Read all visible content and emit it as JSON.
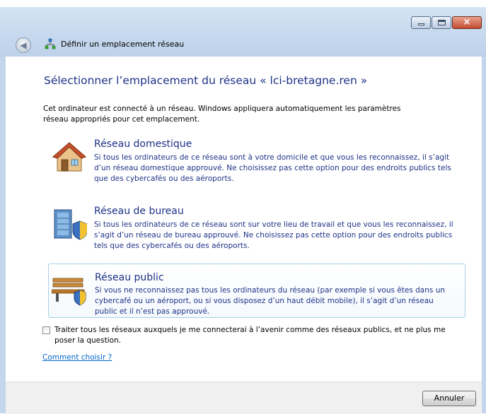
{
  "window": {
    "title": "Définir un emplacement réseau",
    "caption_buttons": {
      "minimize": "minimize",
      "maximize": "maximize",
      "close": "×"
    }
  },
  "nav": {
    "back_glyph": "◀",
    "icon": "network-icon"
  },
  "page": {
    "heading": "Sélectionner l’emplacement du réseau « lci-bretagne.ren »",
    "intro": "Cet ordinateur est connecté à un réseau. Windows appliquera automatiquement les paramètres réseau appropriés pour cet emplacement."
  },
  "options": [
    {
      "title": "Réseau domestique",
      "description": "Si tous les ordinateurs de ce réseau sont à votre domicile et que vous les reconnaissez, il s’agit d’un réseau domestique approuvé. Ne choisissez pas cette option pour des endroits publics tels que des cybercafés ou des aéroports.",
      "icon": "house-icon"
    },
    {
      "title": "Réseau de bureau",
      "description": "Si tous les ordinateurs de ce réseau sont sur votre lieu de travail et que vous les reconnaissez, il s’agit d’un réseau de bureau approuvé. Ne choisissez pas cette option pour des endroits publics tels que des cybercafés ou des aéroports.",
      "icon": "office-building-icon"
    },
    {
      "title": "Réseau public",
      "description": "Si vous ne reconnaissez pas tous les ordinateurs du réseau (par exemple si vous êtes dans un cybercafé ou un aéroport, ou si vous disposez d’un haut débit mobile), il s’agit d’un réseau public et il n’est pas approuvé.",
      "icon": "park-bench-icon"
    }
  ],
  "checkbox": {
    "label": "Traiter tous les réseaux auxquels je me connecterai à l’avenir comme des réseaux publics, et ne plus me poser la question.",
    "checked": false
  },
  "help_link": "Comment choisir ?",
  "footer": {
    "cancel_label": "Annuler"
  },
  "colors": {
    "heading": "#1e3287",
    "link": "#0066cc",
    "titlebar": "#cbdcef"
  }
}
